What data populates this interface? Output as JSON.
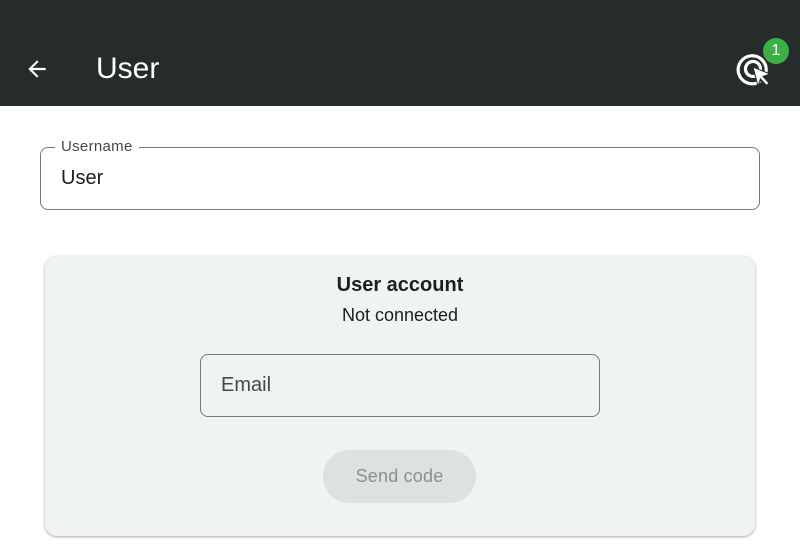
{
  "appbar": {
    "title": "User",
    "back_icon": "arrow-left-icon",
    "action_icon": "target-cursor-icon",
    "badge_count": "1",
    "background_color": "#262b2c",
    "badge_color": "#3cb043"
  },
  "username": {
    "label": "Username",
    "value": "User"
  },
  "account": {
    "title": "User account",
    "status": "Not connected",
    "email_placeholder": "Email",
    "email_value": "",
    "send_label": "Send code",
    "card_color": "#eff3f1"
  }
}
